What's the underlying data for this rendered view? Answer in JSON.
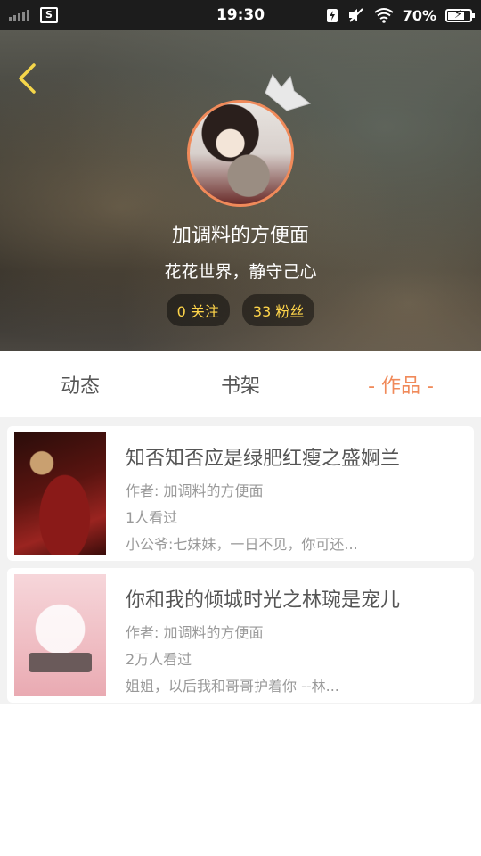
{
  "status_bar": {
    "time": "19:30",
    "battery_percent": "70%",
    "battery_level": 0.7,
    "screenshot_icon_label": "S"
  },
  "profile": {
    "username": "加调料的方便面",
    "signature": "花花世界，静守己心",
    "following_label": "0 关注",
    "followers_label": "33 粉丝"
  },
  "tabs": [
    {
      "label": "动态",
      "active": false
    },
    {
      "label": "书架",
      "active": false
    },
    {
      "label": "- 作品 -",
      "active": true
    }
  ],
  "works": [
    {
      "title": "知否知否应是绿肥红瘦之盛婀兰",
      "author": "作者: 加调料的方便面",
      "views": "1人看过",
      "excerpt": "小公爷:七妹妹，一日不见，你可还..."
    },
    {
      "title": "你和我的倾城时光之林琬是宠儿",
      "author": "作者: 加调料的方便面",
      "views": "2万人看过",
      "excerpt": "姐姐，以后我和哥哥护着你 --林..."
    }
  ],
  "colors": {
    "accent": "#f08a5a",
    "stat_text": "#ffd54a",
    "back_arrow": "#f5d64a"
  }
}
